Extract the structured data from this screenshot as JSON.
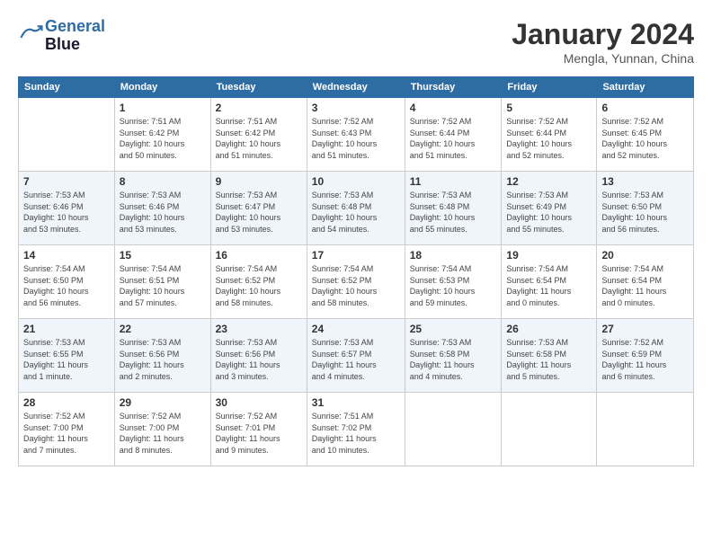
{
  "logo": {
    "line1": "General",
    "line2": "Blue"
  },
  "title": "January 2024",
  "location": "Mengla, Yunnan, China",
  "days_of_week": [
    "Sunday",
    "Monday",
    "Tuesday",
    "Wednesday",
    "Thursday",
    "Friday",
    "Saturday"
  ],
  "weeks": [
    [
      {
        "day": "",
        "info": ""
      },
      {
        "day": "1",
        "info": "Sunrise: 7:51 AM\nSunset: 6:42 PM\nDaylight: 10 hours\nand 50 minutes."
      },
      {
        "day": "2",
        "info": "Sunrise: 7:51 AM\nSunset: 6:42 PM\nDaylight: 10 hours\nand 51 minutes."
      },
      {
        "day": "3",
        "info": "Sunrise: 7:52 AM\nSunset: 6:43 PM\nDaylight: 10 hours\nand 51 minutes."
      },
      {
        "day": "4",
        "info": "Sunrise: 7:52 AM\nSunset: 6:44 PM\nDaylight: 10 hours\nand 51 minutes."
      },
      {
        "day": "5",
        "info": "Sunrise: 7:52 AM\nSunset: 6:44 PM\nDaylight: 10 hours\nand 52 minutes."
      },
      {
        "day": "6",
        "info": "Sunrise: 7:52 AM\nSunset: 6:45 PM\nDaylight: 10 hours\nand 52 minutes."
      }
    ],
    [
      {
        "day": "7",
        "info": "Sunrise: 7:53 AM\nSunset: 6:46 PM\nDaylight: 10 hours\nand 53 minutes."
      },
      {
        "day": "8",
        "info": "Sunrise: 7:53 AM\nSunset: 6:46 PM\nDaylight: 10 hours\nand 53 minutes."
      },
      {
        "day": "9",
        "info": "Sunrise: 7:53 AM\nSunset: 6:47 PM\nDaylight: 10 hours\nand 53 minutes."
      },
      {
        "day": "10",
        "info": "Sunrise: 7:53 AM\nSunset: 6:48 PM\nDaylight: 10 hours\nand 54 minutes."
      },
      {
        "day": "11",
        "info": "Sunrise: 7:53 AM\nSunset: 6:48 PM\nDaylight: 10 hours\nand 55 minutes."
      },
      {
        "day": "12",
        "info": "Sunrise: 7:53 AM\nSunset: 6:49 PM\nDaylight: 10 hours\nand 55 minutes."
      },
      {
        "day": "13",
        "info": "Sunrise: 7:53 AM\nSunset: 6:50 PM\nDaylight: 10 hours\nand 56 minutes."
      }
    ],
    [
      {
        "day": "14",
        "info": "Sunrise: 7:54 AM\nSunset: 6:50 PM\nDaylight: 10 hours\nand 56 minutes."
      },
      {
        "day": "15",
        "info": "Sunrise: 7:54 AM\nSunset: 6:51 PM\nDaylight: 10 hours\nand 57 minutes."
      },
      {
        "day": "16",
        "info": "Sunrise: 7:54 AM\nSunset: 6:52 PM\nDaylight: 10 hours\nand 58 minutes."
      },
      {
        "day": "17",
        "info": "Sunrise: 7:54 AM\nSunset: 6:52 PM\nDaylight: 10 hours\nand 58 minutes."
      },
      {
        "day": "18",
        "info": "Sunrise: 7:54 AM\nSunset: 6:53 PM\nDaylight: 10 hours\nand 59 minutes."
      },
      {
        "day": "19",
        "info": "Sunrise: 7:54 AM\nSunset: 6:54 PM\nDaylight: 11 hours\nand 0 minutes."
      },
      {
        "day": "20",
        "info": "Sunrise: 7:54 AM\nSunset: 6:54 PM\nDaylight: 11 hours\nand 0 minutes."
      }
    ],
    [
      {
        "day": "21",
        "info": "Sunrise: 7:53 AM\nSunset: 6:55 PM\nDaylight: 11 hours\nand 1 minute."
      },
      {
        "day": "22",
        "info": "Sunrise: 7:53 AM\nSunset: 6:56 PM\nDaylight: 11 hours\nand 2 minutes."
      },
      {
        "day": "23",
        "info": "Sunrise: 7:53 AM\nSunset: 6:56 PM\nDaylight: 11 hours\nand 3 minutes."
      },
      {
        "day": "24",
        "info": "Sunrise: 7:53 AM\nSunset: 6:57 PM\nDaylight: 11 hours\nand 4 minutes."
      },
      {
        "day": "25",
        "info": "Sunrise: 7:53 AM\nSunset: 6:58 PM\nDaylight: 11 hours\nand 4 minutes."
      },
      {
        "day": "26",
        "info": "Sunrise: 7:53 AM\nSunset: 6:58 PM\nDaylight: 11 hours\nand 5 minutes."
      },
      {
        "day": "27",
        "info": "Sunrise: 7:52 AM\nSunset: 6:59 PM\nDaylight: 11 hours\nand 6 minutes."
      }
    ],
    [
      {
        "day": "28",
        "info": "Sunrise: 7:52 AM\nSunset: 7:00 PM\nDaylight: 11 hours\nand 7 minutes."
      },
      {
        "day": "29",
        "info": "Sunrise: 7:52 AM\nSunset: 7:00 PM\nDaylight: 11 hours\nand 8 minutes."
      },
      {
        "day": "30",
        "info": "Sunrise: 7:52 AM\nSunset: 7:01 PM\nDaylight: 11 hours\nand 9 minutes."
      },
      {
        "day": "31",
        "info": "Sunrise: 7:51 AM\nSunset: 7:02 PM\nDaylight: 11 hours\nand 10 minutes."
      },
      {
        "day": "",
        "info": ""
      },
      {
        "day": "",
        "info": ""
      },
      {
        "day": "",
        "info": ""
      }
    ]
  ]
}
